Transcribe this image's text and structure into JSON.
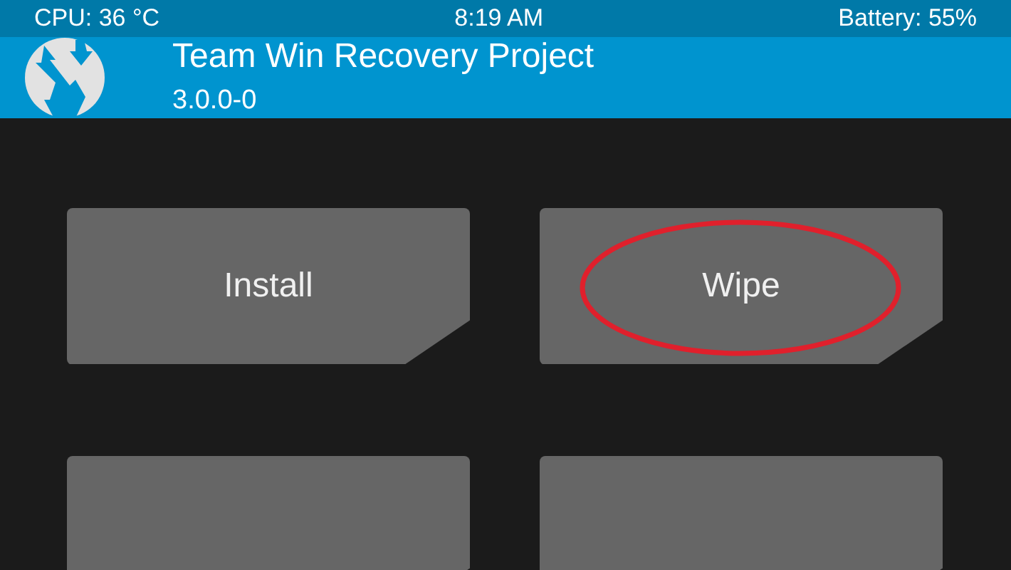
{
  "status_bar": {
    "cpu": "CPU: 36 °C",
    "time": "8:19 AM",
    "battery": "Battery: 55%"
  },
  "header": {
    "title": "Team Win Recovery Project",
    "version": "3.0.0-0"
  },
  "buttons": [
    {
      "label": "Install",
      "circled": false
    },
    {
      "label": "Wipe",
      "circled": true
    },
    {
      "circled": false
    },
    {
      "circled": false
    }
  ]
}
